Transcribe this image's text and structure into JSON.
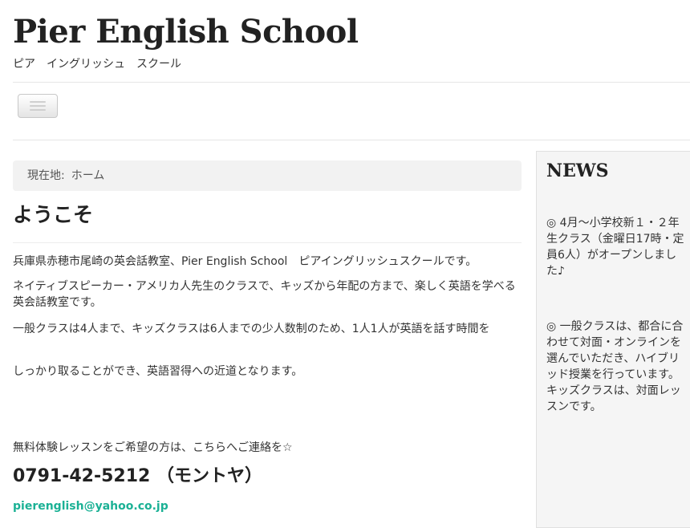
{
  "site": {
    "title": "Pier English School",
    "subtitle": "ピア　イングリッシュ　スクール"
  },
  "nav": {
    "menu_button_icon": "hamburger-icon"
  },
  "breadcrumb": {
    "label": "現在地:",
    "current": "ホーム"
  },
  "main": {
    "heading": "ようこそ",
    "paragraphs": [
      "兵庫県赤穂市尾崎の英会話教室、Pier English School　ピアイングリッシュスクールです。",
      "ネイティブスピーカー・アメリカ人先生のクラスで、キッズから年配の方まで、楽しく英語を学べる英会話教室です。",
      "一般クラスは4人まで、キッズクラスは6人までの少人数制のため、1人1人が英語を話す時間を",
      "しっかり取ることができ、英語習得への近道となります。"
    ],
    "contact_lead": "無料体験レッスンをご希望の方は、こちらへご連絡を☆",
    "phone": "0791-42-5212 （モントヤ）",
    "email": "pierenglish@yahoo.co.jp"
  },
  "sidebar": {
    "news_title": "NEWS",
    "news_items": [
      "◎ 4月～小学校新１・２年生クラス（金曜日17時・定員6人）がオープンしました♪",
      "◎ 一般クラスは、都合に合わせて対面・オンラインを選んでいただき、ハイブリッド授業を行っています。キッズクラスは、対面レッスンです。"
    ]
  },
  "colors": {
    "link": "#1bb195",
    "breadcrumb_bg": "#f2f2f2",
    "sidebar_bg": "#f5f5f5"
  }
}
